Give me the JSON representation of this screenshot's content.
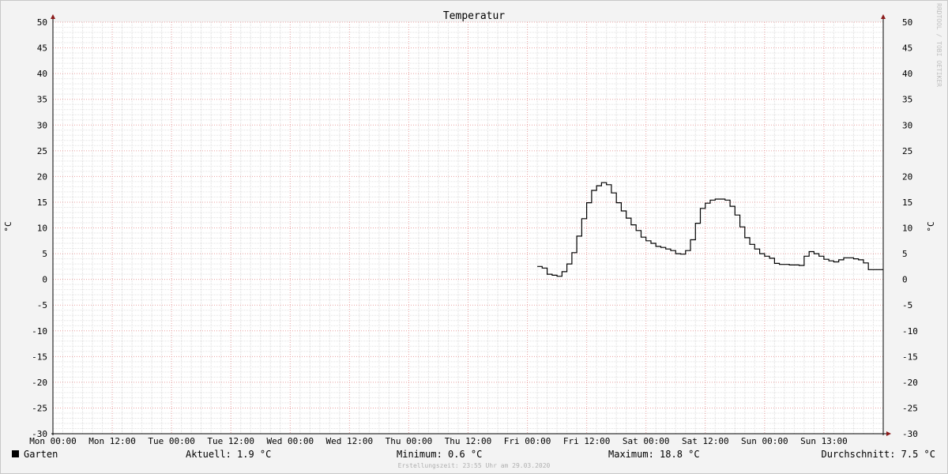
{
  "chart_data": {
    "type": "line",
    "title": "Temperatur",
    "ylabel": "°C",
    "ylabel_right": "°C",
    "ylim": [
      -30,
      50
    ],
    "yticks": [
      50,
      45,
      40,
      35,
      30,
      25,
      20,
      15,
      10,
      5,
      0,
      -5,
      -10,
      -15,
      -20,
      -25,
      -30
    ],
    "xticks": [
      {
        "label": "Mon 00:00",
        "pos": 0
      },
      {
        "label": "Mon 12:00",
        "pos": 12
      },
      {
        "label": "Tue 00:00",
        "pos": 24
      },
      {
        "label": "Tue 12:00",
        "pos": 36
      },
      {
        "label": "Wed 00:00",
        "pos": 48
      },
      {
        "label": "Wed 12:00",
        "pos": 60
      },
      {
        "label": "Thu 00:00",
        "pos": 72
      },
      {
        "label": "Thu 12:00",
        "pos": 84
      },
      {
        "label": "Fri 00:00",
        "pos": 96
      },
      {
        "label": "Fri 12:00",
        "pos": 108
      },
      {
        "label": "Sat 00:00",
        "pos": 120
      },
      {
        "label": "Sat 12:00",
        "pos": 132
      },
      {
        "label": "Sun 00:00",
        "pos": 144
      },
      {
        "label": "Sun 13:00",
        "pos": 156
      }
    ],
    "xlim": [
      0,
      168
    ],
    "grid": true,
    "side_label": "RRDTOOL / TOBI OETIKER",
    "series": [
      {
        "name": "Garten",
        "color": "#000000",
        "x": [
          98,
          99,
          100,
          101,
          102,
          103,
          104,
          105,
          106,
          107,
          108,
          109,
          110,
          111,
          112,
          113,
          114,
          115,
          116,
          117,
          118,
          119,
          120,
          121,
          122,
          123,
          124,
          125,
          126,
          127,
          128,
          129,
          130,
          131,
          132,
          133,
          134,
          135,
          136,
          137,
          138,
          139,
          140,
          141,
          142,
          143,
          144,
          145,
          146,
          147,
          148,
          149,
          150,
          151,
          152,
          153,
          154,
          155,
          156,
          157,
          158,
          159,
          160,
          161,
          162,
          163,
          164,
          165,
          166,
          167
        ],
        "values": [
          2.5,
          2.2,
          1.0,
          0.8,
          0.6,
          1.5,
          3.0,
          5.2,
          8.4,
          11.8,
          14.9,
          17.3,
          18.2,
          18.8,
          18.4,
          16.8,
          14.9,
          13.3,
          11.9,
          10.6,
          9.5,
          8.2,
          7.5,
          7.0,
          6.4,
          6.2,
          5.9,
          5.6,
          5.0,
          4.9,
          5.6,
          7.7,
          10.9,
          13.8,
          14.8,
          15.4,
          15.6,
          15.6,
          15.4,
          14.2,
          12.5,
          10.2,
          8.1,
          6.8,
          5.9,
          5.0,
          4.5,
          4.1,
          3.1,
          2.9,
          2.9,
          2.8,
          2.8,
          2.7,
          4.5,
          5.4,
          5.0,
          4.5,
          3.9,
          3.6,
          3.4,
          3.8,
          4.2,
          4.2,
          4.0,
          3.8,
          3.2,
          1.9,
          1.9,
          1.9
        ]
      }
    ]
  },
  "legend": {
    "series_name": "Garten",
    "current": "Aktuell: 1.9 °C",
    "minimum": "Minimum: 0.6 °C",
    "maximum": "Maximum: 18.8 °C",
    "average": "Durchschnitt: 7.5 °C"
  },
  "footer": {
    "created": "Erstellungszeit: 23:55 Uhr am 29.03.2020"
  }
}
